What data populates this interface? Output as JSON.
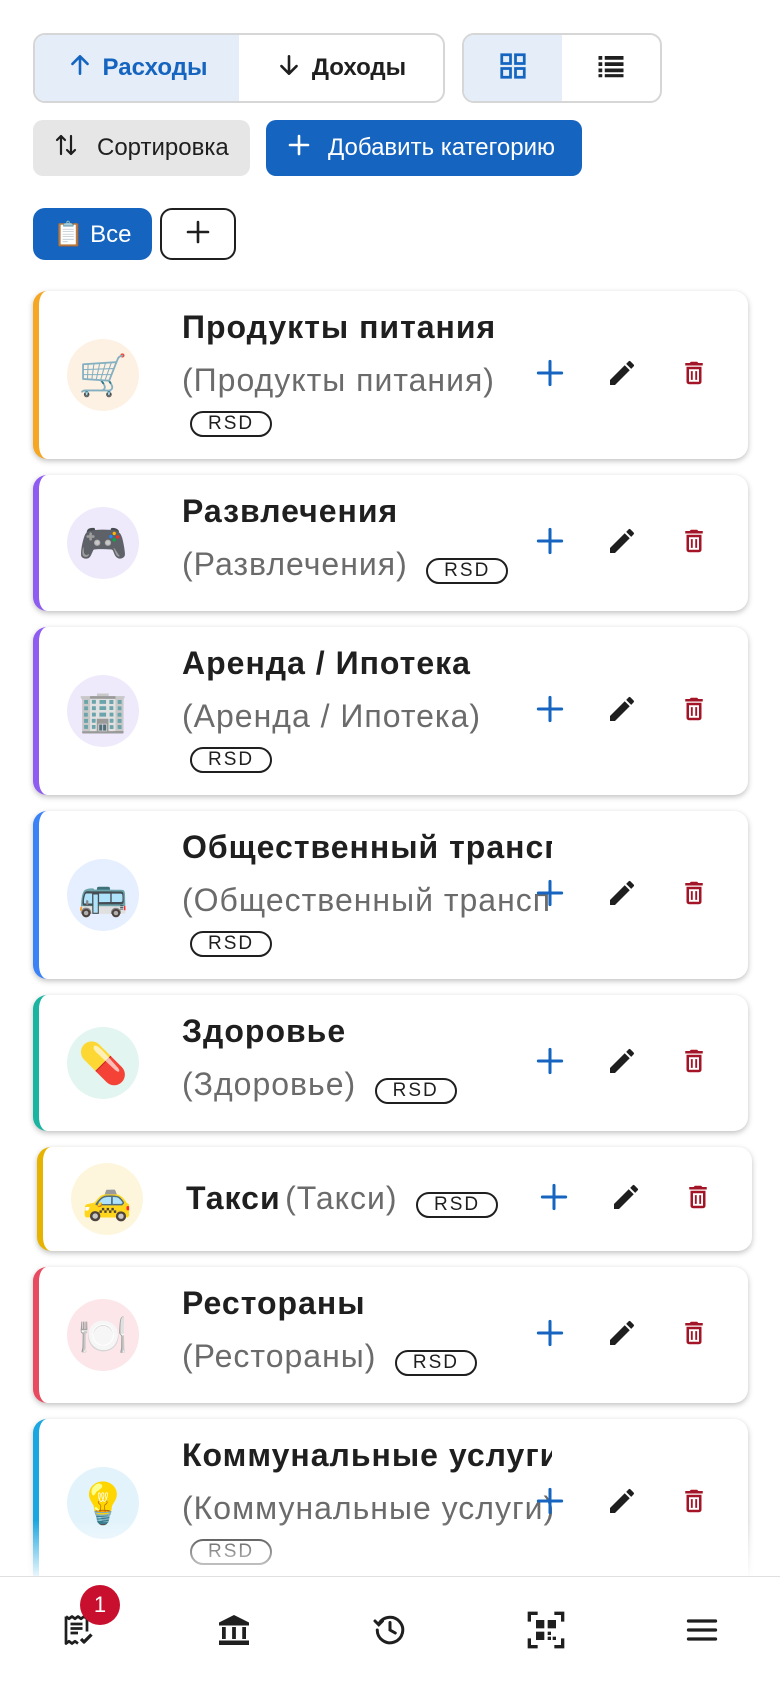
{
  "type_toggle": {
    "expenses_label": "Расходы",
    "income_label": "Доходы",
    "active": "expenses"
  },
  "view_toggle": {
    "active": "grid"
  },
  "toolbar": {
    "sort_label": "Сортировка",
    "add_category_label": "Добавить категорию"
  },
  "filters": {
    "all_label": "📋 Все"
  },
  "colors": {
    "primary": "#1565c0",
    "delete": "#a31526",
    "badge": "#c8102e"
  },
  "categories": [
    {
      "name": "Продукты питания",
      "alias": "(Продукты питания)",
      "currency": "RSD",
      "emoji": "🛒",
      "accent": "#f5a623",
      "icon_bg": "#fdf1e3"
    },
    {
      "name": "Развлечения",
      "alias": "(Развлечения)",
      "currency": "RSD",
      "emoji": "🎮",
      "accent": "#8e5cf0",
      "icon_bg": "#efeafb"
    },
    {
      "name": "Аренда / Ипотека",
      "alias": "(Аренда / Ипотека)",
      "currency": "RSD",
      "emoji": "🏢",
      "accent": "#8e5cf0",
      "icon_bg": "#efeafb"
    },
    {
      "name": "Общественный транспорт",
      "alias": "(Общественный транспорт)",
      "currency": "RSD",
      "emoji": "🚌",
      "accent": "#3b82f6",
      "icon_bg": "#e6efff"
    },
    {
      "name": "Здоровье",
      "alias": "(Здоровье)",
      "currency": "RSD",
      "emoji": "💊",
      "accent": "#1ab5a0",
      "icon_bg": "#e2f5f1"
    },
    {
      "name": "Такси",
      "alias": "(Такси)",
      "currency": "RSD",
      "emoji": "🚕",
      "accent": "#e6b400",
      "icon_bg": "#fdf6dc"
    },
    {
      "name": "Рестораны",
      "alias": "(Рестораны)",
      "currency": "RSD",
      "emoji": "🍽️",
      "accent": "#e84a5f",
      "icon_bg": "#fce6e9"
    },
    {
      "name": "Коммунальные услуги",
      "alias": "(Коммунальные услуги)",
      "currency": "RSD",
      "emoji": "💡",
      "accent": "#1aa6e0",
      "icon_bg": "#e3f3fb"
    }
  ],
  "bottom_nav": {
    "badge_count": "1",
    "items": [
      "receipts-icon",
      "bank-icon",
      "history-icon",
      "qr-scan-icon",
      "menu-icon"
    ]
  }
}
